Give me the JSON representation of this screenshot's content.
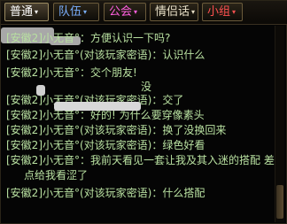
{
  "tabs": [
    {
      "label": "普通",
      "color": "#ffffff",
      "active": true
    },
    {
      "label": "队伍",
      "color": "#7ab0ff",
      "active": false
    },
    {
      "label": "公会",
      "color": "#ff60e0",
      "active": false
    },
    {
      "label": "情侣话",
      "color": "#e8e0c8",
      "active": false
    },
    {
      "label": "小组",
      "color": "#ff5050",
      "active": false
    }
  ],
  "tab_arrow": "▾",
  "messages": [
    {
      "text": "[安徽2]小无音°：方便认识一下吗?"
    },
    {
      "text": "[安徽2]小无音°(对该玩家密语)：认识什么"
    },
    {
      "text": "[安徽2]小无音°：交个朋友!"
    },
    {
      "text": "没"
    },
    {
      "text": "[安徽2]小无音°(对该玩家密语)：交了"
    },
    {
      "text": "[安徽2]小无音°：好的! 为什么要穿像素头"
    },
    {
      "text": "[安徽2]小无音°(对该玩家密语)：换了没换回来"
    },
    {
      "text": "[安徽2]小无音°(对该玩家密语)：绿色好看"
    },
    {
      "text": "[安徽2]小无音°：我前天看见一套让我及其入迷的搭配 差"
    },
    {
      "text": "点给我看涩了"
    },
    {
      "text": "[安徽2]小无音°(对该玩家密语)：什么搭配"
    }
  ]
}
